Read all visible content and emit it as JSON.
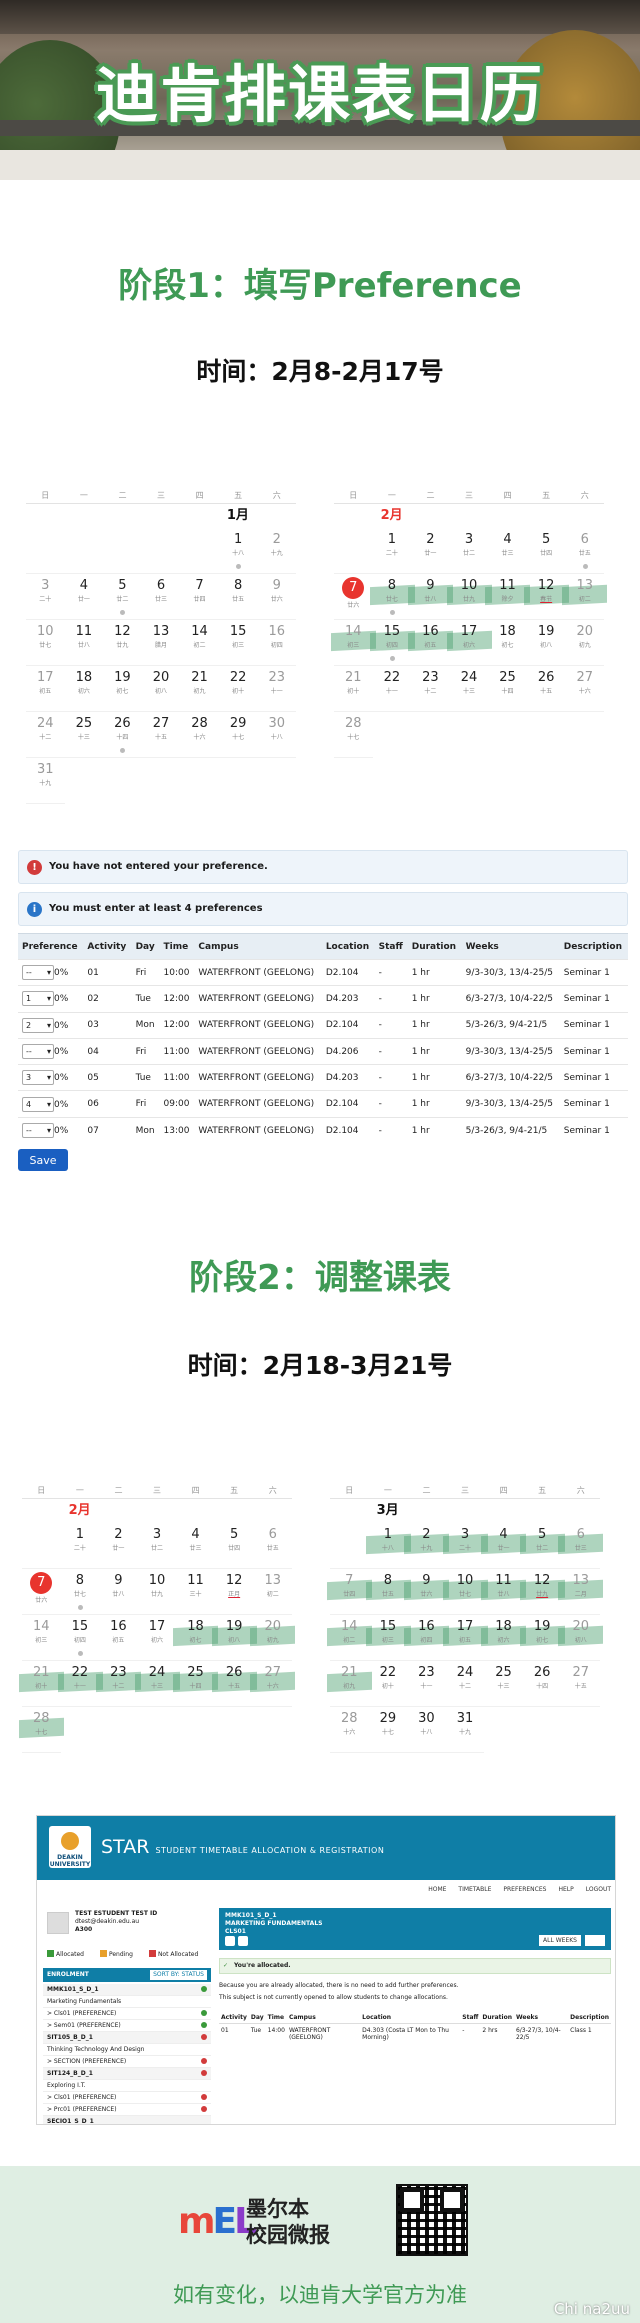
{
  "header": {
    "title": "迪肯排课表日历"
  },
  "stage1": {
    "title": "阶段1：填写Preference",
    "time": "时间：2月8-2月17号"
  },
  "stage2": {
    "title": "阶段2：调整课表",
    "time": "时间：2月18-3月21号"
  },
  "weekdays": [
    "日",
    "一",
    "二",
    "三",
    "四",
    "五",
    "六"
  ],
  "cal1": {
    "jan": {
      "name": "1月",
      "offset": 5,
      "days": [
        [
          "1",
          "十八"
        ],
        [
          "2",
          "十九"
        ],
        [
          "3",
          "二十"
        ],
        [
          "4",
          "廿一"
        ],
        [
          "5",
          "廿二"
        ],
        [
          "6",
          "廿三"
        ],
        [
          "7",
          "廿四"
        ],
        [
          "8",
          "廿五"
        ],
        [
          "9",
          "廿六"
        ],
        [
          "10",
          "廿七"
        ],
        [
          "11",
          "廿八"
        ],
        [
          "12",
          "廿九"
        ],
        [
          "13",
          "腊月"
        ],
        [
          "14",
          "初二"
        ],
        [
          "15",
          "初三"
        ],
        [
          "16",
          "初四"
        ],
        [
          "17",
          "初五"
        ],
        [
          "18",
          "初六"
        ],
        [
          "19",
          "初七"
        ],
        [
          "20",
          "初八"
        ],
        [
          "21",
          "初九"
        ],
        [
          "22",
          "初十"
        ],
        [
          "23",
          "十一"
        ],
        [
          "24",
          "十二"
        ],
        [
          "25",
          "十三"
        ],
        [
          "26",
          "十四"
        ],
        [
          "27",
          "十五"
        ],
        [
          "28",
          "十六"
        ],
        [
          "29",
          "十七"
        ],
        [
          "30",
          "十八"
        ],
        [
          "31",
          "十九"
        ]
      ]
    },
    "feb": {
      "name": "2月",
      "offset": 1,
      "days": [
        [
          "1",
          "二十"
        ],
        [
          "2",
          "廿一"
        ],
        [
          "3",
          "廿二"
        ],
        [
          "4",
          "廿三"
        ],
        [
          "5",
          "廿四"
        ],
        [
          "6",
          "廿五"
        ],
        [
          "7",
          "廿六"
        ],
        [
          "8",
          "廿七"
        ],
        [
          "9",
          "廿八"
        ],
        [
          "10",
          "廿九"
        ],
        [
          "11",
          "除夕"
        ],
        [
          "12",
          "春节"
        ],
        [
          "13",
          "初二"
        ],
        [
          "14",
          "初三"
        ],
        [
          "15",
          "初四"
        ],
        [
          "16",
          "初五"
        ],
        [
          "17",
          "初六"
        ],
        [
          "18",
          "初七"
        ],
        [
          "19",
          "初八"
        ],
        [
          "20",
          "初九"
        ],
        [
          "21",
          "初十"
        ],
        [
          "22",
          "十一"
        ],
        [
          "23",
          "十二"
        ],
        [
          "24",
          "十三"
        ],
        [
          "25",
          "十四"
        ],
        [
          "26",
          "十五"
        ],
        [
          "27",
          "十六"
        ],
        [
          "28",
          "十七"
        ]
      ]
    }
  },
  "cal2": {
    "feb": {
      "name": "2月",
      "offset": 1,
      "days": [
        [
          "1",
          "二十"
        ],
        [
          "2",
          "廿一"
        ],
        [
          "3",
          "廿二"
        ],
        [
          "4",
          "廿三"
        ],
        [
          "5",
          "廿四"
        ],
        [
          "6",
          "廿五"
        ],
        [
          "7",
          "廿六"
        ],
        [
          "8",
          "廿七"
        ],
        [
          "9",
          "廿八"
        ],
        [
          "10",
          "廿九"
        ],
        [
          "11",
          "三十"
        ],
        [
          "12",
          "正月"
        ],
        [
          "13",
          "初二"
        ],
        [
          "14",
          "初三"
        ],
        [
          "15",
          "初四"
        ],
        [
          "16",
          "初五"
        ],
        [
          "17",
          "初六"
        ],
        [
          "18",
          "初七"
        ],
        [
          "19",
          "初八"
        ],
        [
          "20",
          "初九"
        ],
        [
          "21",
          "初十"
        ],
        [
          "22",
          "十一"
        ],
        [
          "23",
          "十二"
        ],
        [
          "24",
          "十三"
        ],
        [
          "25",
          "十四"
        ],
        [
          "26",
          "十五"
        ],
        [
          "27",
          "十六"
        ],
        [
          "28",
          "十七"
        ]
      ]
    },
    "mar": {
      "name": "3月",
      "offset": 1,
      "days": [
        [
          "1",
          "十八"
        ],
        [
          "2",
          "十九"
        ],
        [
          "3",
          "二十"
        ],
        [
          "4",
          "廿一"
        ],
        [
          "5",
          "廿二"
        ],
        [
          "6",
          "廿三"
        ],
        [
          "7",
          "廿四"
        ],
        [
          "8",
          "廿五"
        ],
        [
          "9",
          "廿六"
        ],
        [
          "10",
          "廿七"
        ],
        [
          "11",
          "廿八"
        ],
        [
          "12",
          "廿九"
        ],
        [
          "13",
          "二月"
        ],
        [
          "14",
          "初二"
        ],
        [
          "15",
          "初三"
        ],
        [
          "16",
          "初四"
        ],
        [
          "17",
          "初五"
        ],
        [
          "18",
          "初六"
        ],
        [
          "19",
          "初七"
        ],
        [
          "20",
          "初八"
        ],
        [
          "21",
          "初九"
        ],
        [
          "22",
          "初十"
        ],
        [
          "23",
          "十一"
        ],
        [
          "24",
          "十二"
        ],
        [
          "25",
          "十三"
        ],
        [
          "26",
          "十四"
        ],
        [
          "27",
          "十五"
        ],
        [
          "28",
          "十六"
        ],
        [
          "29",
          "十七"
        ],
        [
          "30",
          "十八"
        ],
        [
          "31",
          "十九"
        ]
      ]
    }
  },
  "alerts": {
    "error": "You have not entered your preference.",
    "info": "You must enter at least 4 preferences"
  },
  "pref_table": {
    "headers": [
      "Preference",
      "Activity",
      "Day",
      "Time",
      "Campus",
      "Location",
      "Staff",
      "Duration",
      "Weeks",
      "Description"
    ],
    "rows": [
      [
        "--",
        "0%",
        "01",
        "Fri",
        "10:00",
        "WATERFRONT (GEELONG)",
        "D2.104",
        "-",
        "1 hr",
        "9/3-30/3, 13/4-25/5",
        "Seminar 1"
      ],
      [
        "1",
        "0%",
        "02",
        "Tue",
        "12:00",
        "WATERFRONT (GEELONG)",
        "D4.203",
        "-",
        "1 hr",
        "6/3-27/3, 10/4-22/5",
        "Seminar 1"
      ],
      [
        "2",
        "0%",
        "03",
        "Mon",
        "12:00",
        "WATERFRONT (GEELONG)",
        "D2.104",
        "-",
        "1 hr",
        "5/3-26/3, 9/4-21/5",
        "Seminar 1"
      ],
      [
        "--",
        "0%",
        "04",
        "Fri",
        "11:00",
        "WATERFRONT (GEELONG)",
        "D4.206",
        "-",
        "1 hr",
        "9/3-30/3, 13/4-25/5",
        "Seminar 1"
      ],
      [
        "3",
        "0%",
        "05",
        "Tue",
        "11:00",
        "WATERFRONT (GEELONG)",
        "D4.203",
        "-",
        "1 hr",
        "6/3-27/3, 10/4-22/5",
        "Seminar 1"
      ],
      [
        "4",
        "0%",
        "06",
        "Fri",
        "09:00",
        "WATERFRONT (GEELONG)",
        "D2.104",
        "-",
        "1 hr",
        "9/3-30/3, 13/4-25/5",
        "Seminar 1"
      ],
      [
        "--",
        "0%",
        "07",
        "Mon",
        "13:00",
        "WATERFRONT (GEELONG)",
        "D2.104",
        "-",
        "1 hr",
        "5/3-26/3, 9/4-21/5",
        "Seminar 1"
      ]
    ],
    "save_label": "Save"
  },
  "star": {
    "logo_text": "DEAKIN UNIVERSITY",
    "brand": "STAR",
    "brand_sub": "STUDENT TIMETABLE ALLOCATION & REGISTRATION",
    "nav": [
      "HOME",
      "TIMETABLE",
      "PREFERENCES",
      "HELP",
      "LOGOUT"
    ],
    "user": [
      "TEST ESTUDENT TEST ID",
      "dtest@deakin.edu.au",
      "A300"
    ],
    "legend": [
      "Allocated",
      "Pending",
      "Not Allocated"
    ],
    "legend_colors": [
      "#3a9a3a",
      "#e8a02b",
      "#d23b3b"
    ],
    "enrolment": "ENROLMENT",
    "sort": "SORT BY: STATUS",
    "units": [
      {
        "t": "MMK101_S_D_1",
        "h": true,
        "c": "#3a9a3a"
      },
      {
        "t": "Marketing Fundamentals",
        "h": false,
        "c": ""
      },
      {
        "t": "> Cls01 (PREFERENCE)",
        "h": false,
        "c": "#3a9a3a"
      },
      {
        "t": "> Sem01 (PREFERENCE)",
        "h": false,
        "c": "#3a9a3a"
      },
      {
        "t": "SIT105_B_D_1",
        "h": true,
        "c": "#d23b3b"
      },
      {
        "t": "Thinking Technology And Design",
        "h": false,
        "c": ""
      },
      {
        "t": "> SECTION (PREFERENCE)",
        "h": false,
        "c": "#d23b3b"
      },
      {
        "t": "SIT124_B_D_1",
        "h": true,
        "c": "#d23b3b"
      },
      {
        "t": "Exploring I.T.",
        "h": false,
        "c": ""
      },
      {
        "t": "> Cls01 (PREFERENCE)",
        "h": false,
        "c": "#d23b3b"
      },
      {
        "t": "> Prc01 (PREFERENCE)",
        "h": false,
        "c": "#d23b3b"
      },
      {
        "t": "SECIO1_S_D_1",
        "h": true,
        "c": ""
      }
    ],
    "course": [
      "MMK101_S_D_1",
      "MARKETING FUNDAMENTALS",
      "CLS01"
    ],
    "all_weeks": "ALL WEEKS",
    "allocated": "You're allocated.",
    "msg1": "Because you are already allocated, there is no need to add further preferences.",
    "msg2": "This subject is not currently opened to allow students to change allocations.",
    "act_headers": [
      "Activity",
      "Day",
      "Time",
      "Campus",
      "Location",
      "Staff",
      "Duration",
      "Weeks",
      "Description"
    ],
    "act_row": [
      "01",
      "Tue",
      "14:00",
      "WATERFRONT (GEELONG)",
      "D4.303 (Costa LT Mon to Thu Morning)",
      "-",
      "2 hrs",
      "6/3-27/3, 10/4-22/5",
      "Class 1"
    ]
  },
  "footer": {
    "logo_letters": [
      "m",
      "E",
      "L"
    ],
    "brand_line1": "墨尔本",
    "brand_line2": "校园微报",
    "note": "如有变化，以迪肯大学官方为准",
    "watermark": "Chi na2uu"
  }
}
